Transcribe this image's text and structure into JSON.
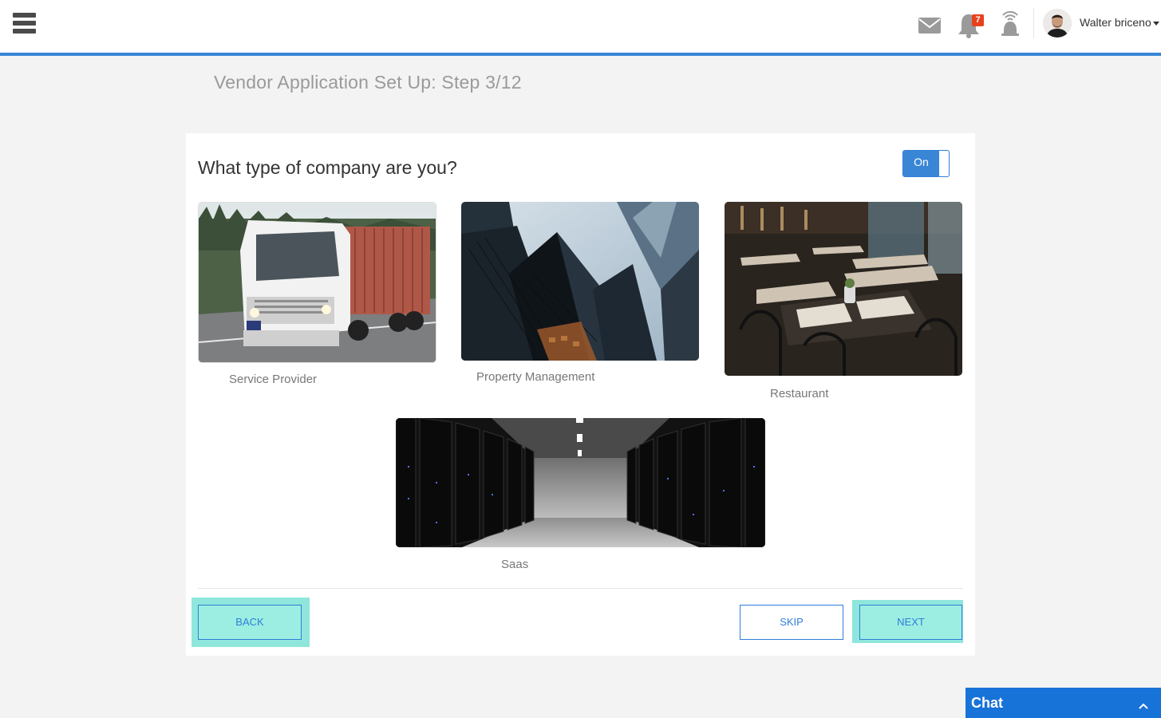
{
  "header": {
    "user_name": "Walter briceno",
    "notification_count": "7"
  },
  "page": {
    "title": "Vendor Application Set Up: Step 3/12"
  },
  "question": {
    "text": "What type of company are you?",
    "toggle_label": "On"
  },
  "options": [
    {
      "label": "Service Provider",
      "image": "truck-photo"
    },
    {
      "label": "Property Management",
      "image": "skyscrapers-photo"
    },
    {
      "label": "Restaurant",
      "image": "restaurant-interior-photo"
    },
    {
      "label": "Saas",
      "image": "server-room-photo"
    }
  ],
  "buttons": {
    "back": "BACK",
    "skip": "SKIP",
    "next": "NEXT"
  },
  "chat": {
    "label": "Chat"
  },
  "colors": {
    "accent": "#3a86d6",
    "highlight": "#9ceee2",
    "chat": "#1873d8",
    "badge": "#e8411c"
  }
}
